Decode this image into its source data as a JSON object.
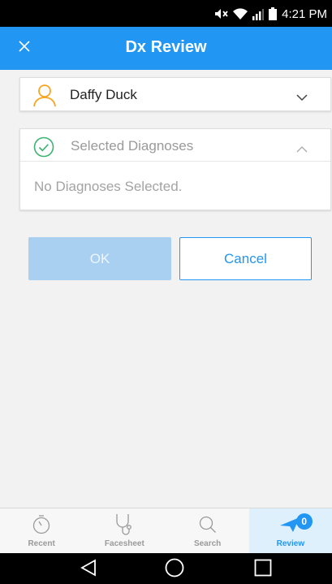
{
  "status_bar": {
    "time": "4:21 PM"
  },
  "app_bar": {
    "title": "Dx Review",
    "close_icon": "close-icon"
  },
  "patient": {
    "name": "Daffy Duck",
    "icon": "user-icon"
  },
  "diagnoses": {
    "title": "Selected Diagnoses",
    "empty_text": "No Diagnoses Selected.",
    "icon": "check-circle-icon"
  },
  "actions": {
    "ok_label": "OK",
    "cancel_label": "Cancel"
  },
  "tabs": [
    {
      "label": "Recent",
      "icon": "timer-icon"
    },
    {
      "label": "Facesheet",
      "icon": "stethoscope-icon"
    },
    {
      "label": "Search",
      "icon": "search-icon"
    },
    {
      "label": "Review",
      "icon": "send-icon",
      "badge": "0",
      "active": true
    }
  ],
  "colors": {
    "primary": "#2196f3",
    "accent_orange": "#f5a623",
    "success_green": "#3cb371"
  }
}
